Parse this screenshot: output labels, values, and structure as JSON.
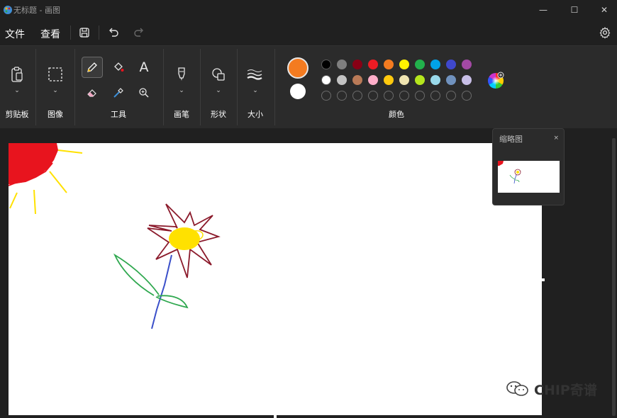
{
  "window": {
    "title": "无标题 - 画图",
    "controls": {
      "minimize": "—",
      "maximize": "☐",
      "close": "✕"
    }
  },
  "menu": {
    "file": "文件",
    "view": "查看",
    "icons": [
      "save-icon",
      "undo-icon",
      "redo-icon",
      "settings-icon"
    ]
  },
  "ribbon": {
    "groups": {
      "clipboard": "剪贴板",
      "image": "图像",
      "tools": "工具",
      "brushes": "画笔",
      "shapes": "形状",
      "size": "大小",
      "colors": "颜色"
    },
    "tools": [
      "pencil-icon",
      "fill-icon",
      "text-icon",
      "eraser-icon",
      "color-picker-icon",
      "magnifier-icon"
    ],
    "text_tool_glyph": "A",
    "selected_tool": "pencil",
    "current_colors": {
      "primary": "#f47b20",
      "secondary": "#ffffff"
    },
    "palette": {
      "row1": [
        "#000000",
        "#7f7f7f",
        "#880015",
        "#ed1c24",
        "#f47b20",
        "#fff200",
        "#22b14c",
        "#00a2e8",
        "#3f48cc",
        "#a349a4"
      ],
      "row2": [
        "#ffffff",
        "#c3c3c3",
        "#b97a57",
        "#ffaec9",
        "#ffc90e",
        "#efe4b0",
        "#b5e61d",
        "#99d9ea",
        "#7092be",
        "#c8bfe7"
      ],
      "row3_empty": 10
    }
  },
  "thumbnail": {
    "title": "缩略图",
    "close": "×"
  },
  "watermark": {
    "text": "CHIP奇谱"
  },
  "colors": {
    "accent_orange": "#f47b20",
    "flower_red": "#8b1a2b",
    "center_yellow": "#ffe100",
    "stem_blue": "#3a4fc9",
    "leaf_green": "#2fa84f",
    "sun_red": "#e8141e"
  }
}
